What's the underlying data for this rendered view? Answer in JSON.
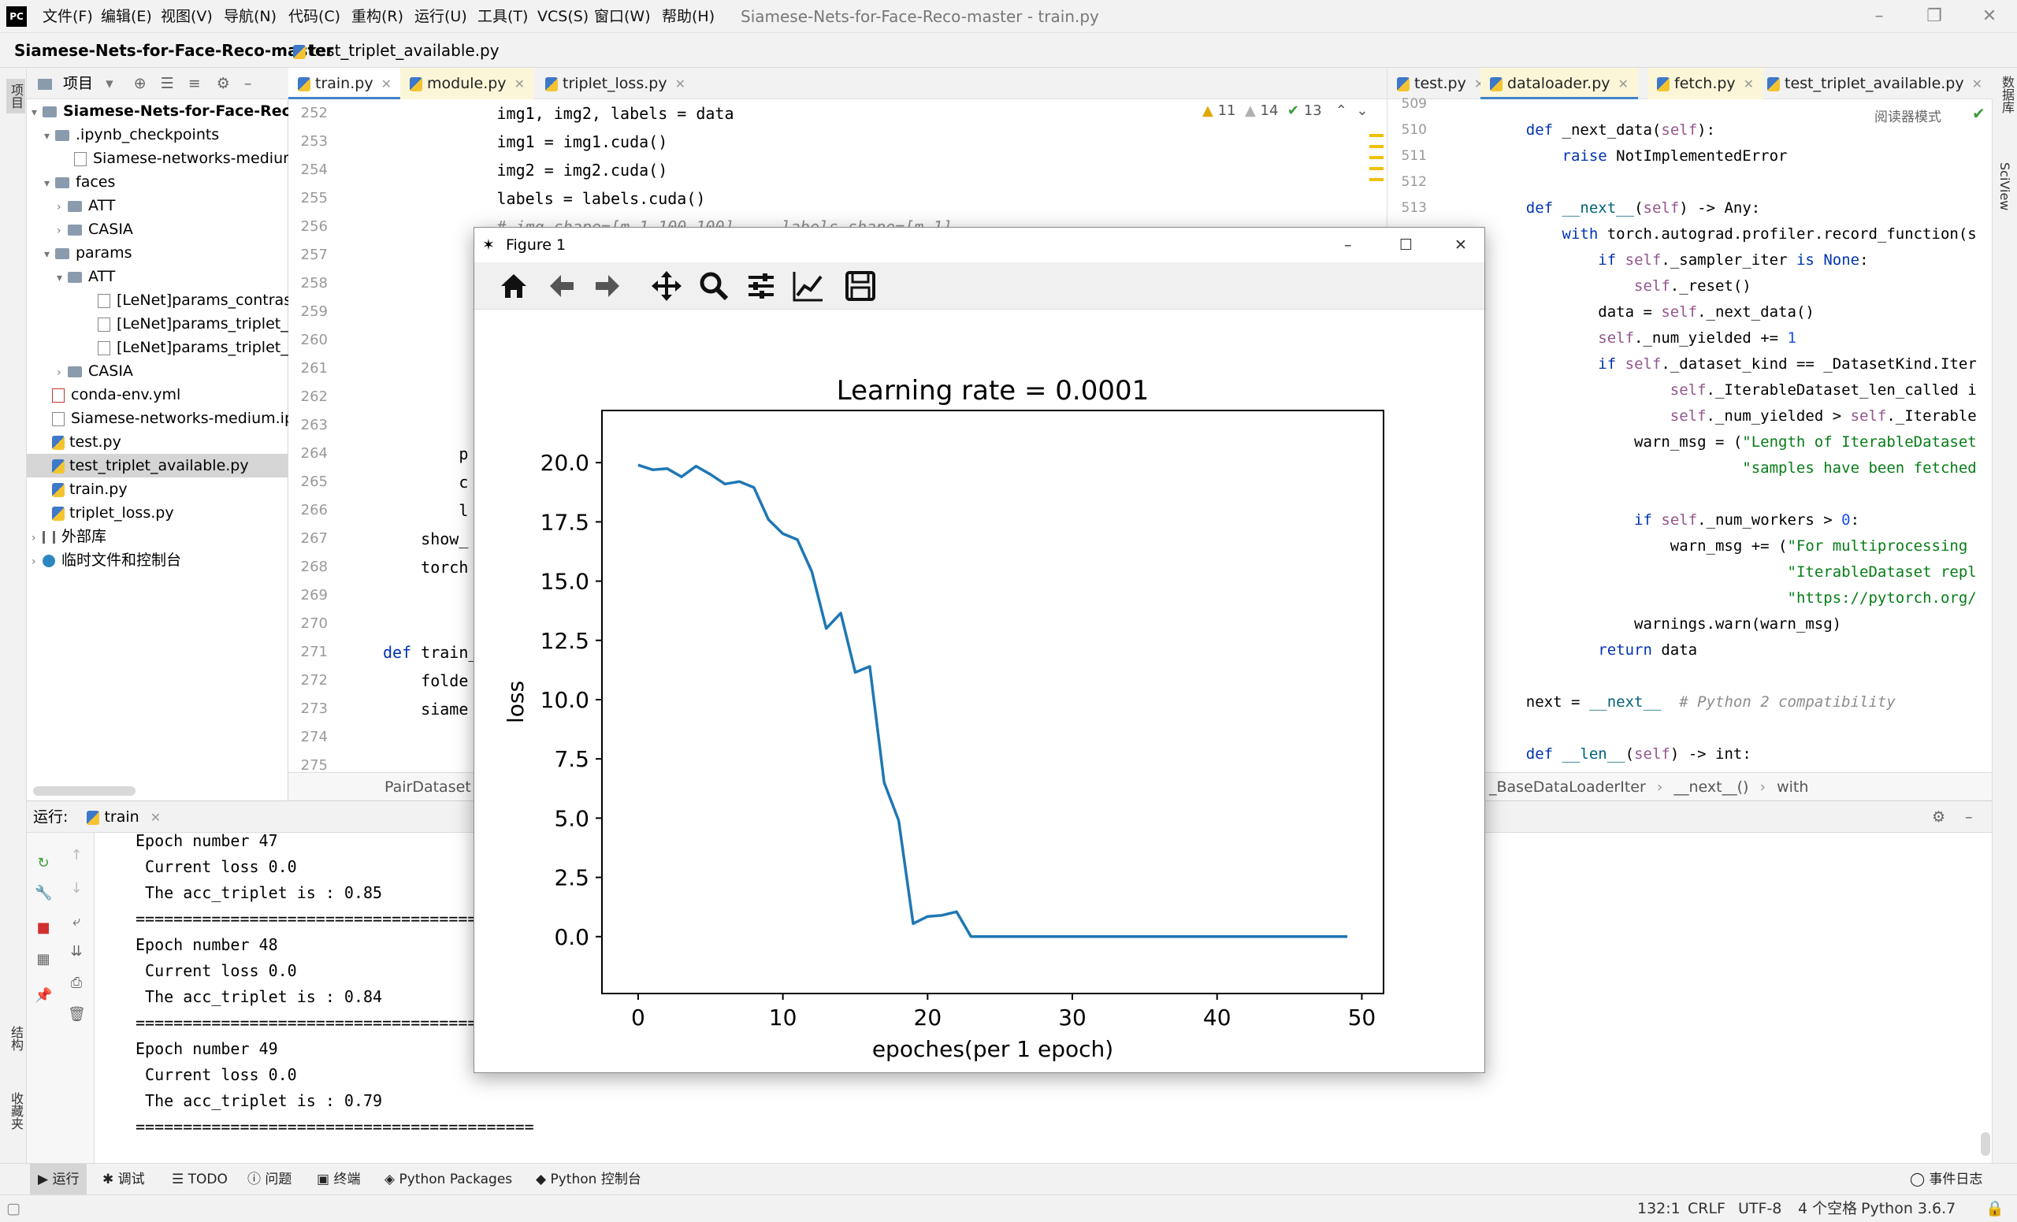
{
  "menubar": {
    "logo": "PC",
    "items": [
      "文件(F)",
      "编辑(E)",
      "视图(V)",
      "导航(N)",
      "代码(C)",
      "重构(R)",
      "运行(U)",
      "工具(T)",
      "VCS(S)",
      "窗口(W)",
      "帮助(H)"
    ],
    "window_title": "Siamese-Nets-for-Face-Reco-master - train.py"
  },
  "navbar": {
    "project": "Siamese-Nets-for-Face-Reco-master",
    "current_file": "test_triplet_available.py",
    "run_config": "train"
  },
  "left_strip": {
    "project_label": "项目",
    "structure_label": "结构",
    "favorites_label": "收藏夹"
  },
  "right_strip": {
    "database_label": "数据库",
    "sciview_label": "SciView"
  },
  "project_panel": {
    "title": "项目",
    "items": [
      {
        "label": "Siamese-Nets-for-Face-Reco-mas",
        "kind": "root"
      },
      {
        "label": ".ipynb_checkpoints",
        "kind": "folder"
      },
      {
        "label": "Siamese-networks-medium-",
        "kind": "file"
      },
      {
        "label": "faces",
        "kind": "folder"
      },
      {
        "label": "ATT",
        "kind": "folder"
      },
      {
        "label": "CASIA",
        "kind": "folder"
      },
      {
        "label": "params",
        "kind": "folder"
      },
      {
        "label": "ATT",
        "kind": "folder"
      },
      {
        "label": "[LeNet]params_contrastiv",
        "kind": "file"
      },
      {
        "label": "[LeNet]params_triplet_ba",
        "kind": "file"
      },
      {
        "label": "[LeNet]params_triplet_ba",
        "kind": "file"
      },
      {
        "label": "CASIA",
        "kind": "folder"
      },
      {
        "label": "conda-env.yml",
        "kind": "file"
      },
      {
        "label": "Siamese-networks-medium.ipyn",
        "kind": "file"
      },
      {
        "label": "test.py",
        "kind": "py"
      },
      {
        "label": "test_triplet_available.py",
        "kind": "py"
      },
      {
        "label": "train.py",
        "kind": "py"
      },
      {
        "label": "triplet_loss.py",
        "kind": "py"
      },
      {
        "label": "外部库",
        "kind": "lib"
      },
      {
        "label": "临时文件和控制台",
        "kind": "lib"
      }
    ]
  },
  "editor_left": {
    "tabs": [
      "train.py",
      "module.py",
      "triplet_loss.py"
    ],
    "inspections": {
      "warnings": "11",
      "weak": "14",
      "ok": "13"
    },
    "line_numbers": [
      "252",
      "253",
      "254",
      "255",
      "256",
      "257",
      "258",
      "259",
      "260",
      "261",
      "262",
      "263",
      "264",
      "265",
      "266",
      "267",
      "268",
      "269",
      "270",
      "271",
      "272",
      "273",
      "274",
      "275"
    ],
    "lines": [
      "            img1, img2, labels = data",
      "            img1 = img1.cuda()",
      "            img2 = img2.cuda()",
      "            labels = labels.cuda()",
      "            # img shape=[m,1,100,100]     labels shape=[m,1]",
      "",
      "",
      "",
      "",
      "",
      "",
      "",
      "        p",
      "        c",
      "        l",
      "    show_",
      "    torch",
      "",
      "",
      "def train_",
      "    folde",
      "    siame",
      "",
      ""
    ],
    "breadcrumb": "PairDataset"
  },
  "editor_right": {
    "tabs": [
      "test.py",
      "dataloader.py",
      "fetch.py",
      "test_triplet_available.py"
    ],
    "reader_mode": "阅读器模式",
    "line_numbers": [
      "509",
      "510",
      "511",
      "512",
      "513"
    ],
    "lines": [
      "",
      "    def _next_data(self):",
      "        raise NotImplementedError",
      "",
      "    def __next__(self) -> Any:",
      "        with torch.autograd.profiler.record_function(s",
      "            if self._sampler_iter is None:",
      "                self._reset()",
      "            data = self._next_data()",
      "            self._num_yielded += 1",
      "            if self._dataset_kind == _DatasetKind.Iter",
      "                    self._IterableDataset_len_called i",
      "                    self._num_yielded > self._Iterable",
      "                warn_msg = (\"Length of IterableDataset",
      "                            \"samples have been fetched",
      "",
      "                if self._num_workers > 0:",
      "                    warn_msg += (\"For multiprocessing",
      "                                 \"IterableDataset repl",
      "                                 \"https://pytorch.org/",
      "                warnings.warn(warn_msg)",
      "            return data",
      "",
      "    next = __next__  # Python 2 compatibility",
      "",
      "    def __len__(self) -> int:"
    ],
    "breadcrumb": [
      "_BaseDataLoaderIter",
      "__next__()",
      "with torch.autograd.profiler.re..."
    ]
  },
  "run_panel": {
    "label": "运行:",
    "tab": "train",
    "output": [
      "Epoch number 47",
      " Current loss 0.0",
      " The acc_triplet is : 0.85",
      "==========================================",
      "Epoch number 48",
      " Current loss 0.0",
      " The acc_triplet is : 0.84",
      "==========================================",
      "Epoch number 49",
      " Current loss 0.0",
      " The acc_triplet is : 0.79",
      "=========================================="
    ]
  },
  "bottom_tabs": [
    "运行",
    "调试",
    "TODO",
    "问题",
    "终端",
    "Python Packages",
    "Python 控制台"
  ],
  "event_log": "事件日志",
  "status": {
    "position": "132:1",
    "line_sep": "CRLF",
    "encoding": "UTF-8",
    "indent": "4 个空格",
    "interpreter": "Python 3.6.7"
  },
  "figure": {
    "window_title": "Figure 1",
    "toolbar_icons": [
      "home-icon",
      "back-icon",
      "forward-icon",
      "pan-icon",
      "zoom-icon",
      "configure-icon",
      "edit-axis-icon",
      "save-icon"
    ]
  },
  "chart_data": {
    "type": "line",
    "title": "Learning rate = 0.0001",
    "xlabel": "epoches(per 1 epoch)",
    "ylabel": "loss",
    "xlim": [
      -2.5,
      51.5
    ],
    "ylim": [
      -2.4,
      22.2
    ],
    "xticks": [
      0,
      10,
      20,
      30,
      40,
      50
    ],
    "yticks": [
      0.0,
      2.5,
      5.0,
      7.5,
      10.0,
      12.5,
      15.0,
      17.5,
      20.0
    ],
    "ytick_labels": [
      "0.0",
      "2.5",
      "5.0",
      "7.5",
      "10.0",
      "12.5",
      "15.0",
      "17.5",
      "20.0"
    ],
    "grid": false,
    "color": "#1f77b4",
    "x": [
      0,
      1,
      2,
      3,
      4,
      5,
      6,
      7,
      8,
      9,
      10,
      11,
      12,
      13,
      14,
      15,
      16,
      17,
      18,
      19,
      20,
      21,
      22,
      23,
      24,
      25,
      26,
      27,
      28,
      29,
      30,
      31,
      32,
      33,
      34,
      35,
      36,
      37,
      38,
      39,
      40,
      41,
      42,
      43,
      44,
      45,
      46,
      47,
      48,
      49
    ],
    "y": [
      19.9,
      19.7,
      19.75,
      19.4,
      19.85,
      19.5,
      19.1,
      19.2,
      18.95,
      17.6,
      17.0,
      16.75,
      15.4,
      13.0,
      13.65,
      11.15,
      11.4,
      6.5,
      4.9,
      0.55,
      0.85,
      0.9,
      1.05,
      0.0,
      0.0,
      0.0,
      0.0,
      0.0,
      0.0,
      0.0,
      0.0,
      0.0,
      0.0,
      0.0,
      0.0,
      0.0,
      0.0,
      0.0,
      0.0,
      0.0,
      0.0,
      0.0,
      0.0,
      0.0,
      0.0,
      0.0,
      0.0,
      0.0,
      0.0,
      0.0
    ]
  }
}
